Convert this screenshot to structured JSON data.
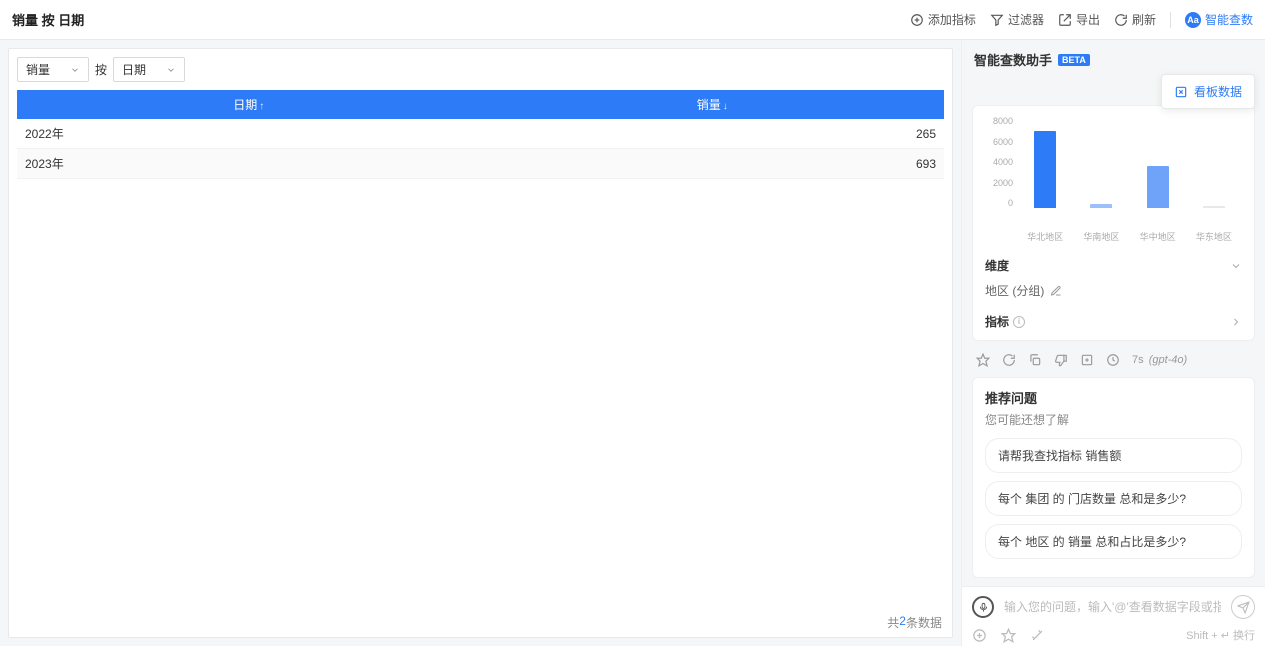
{
  "header": {
    "title": "销量 按 日期",
    "actions": {
      "add_metric": "添加指标",
      "filter": "过滤器",
      "export": "导出",
      "refresh": "刷新"
    },
    "brand": "智能查数"
  },
  "selectors": {
    "metric": "销量",
    "by_word": "按",
    "dimension": "日期"
  },
  "table": {
    "headers": {
      "date": "日期",
      "value": "销量",
      "sort_date": "↑",
      "sort_value": "↓"
    },
    "rows": [
      {
        "date": "2022年",
        "value": "265"
      },
      {
        "date": "2023年",
        "value": "693"
      }
    ],
    "footer_prefix": "共",
    "footer_count": "2",
    "footer_suffix": "条数据"
  },
  "assistant": {
    "title": "智能查数助手",
    "beta": "BETA",
    "kanban_btn": "看板数据",
    "chart_data": {
      "type": "bar",
      "y_ticks": [
        "8000",
        "6000",
        "4000",
        "2000",
        "0"
      ],
      "ylim": [
        0,
        8000
      ],
      "categories": [
        "华北地区",
        "华南地区",
        "华中地区",
        "华东地区"
      ],
      "values": [
        7000,
        400,
        3800,
        0
      ],
      "colors": [
        "#2d7bf6",
        "#9cc0fb",
        "#6fa3f9",
        "#e8e8e8"
      ]
    },
    "dimension_label": "维度",
    "dimension_value": "地区 (分组)",
    "metric_label": "指标",
    "result": {
      "timing": "7s",
      "model": "(gpt-4o)"
    },
    "suggestions": {
      "title": "推荐问题",
      "subtitle": "您可能还想了解",
      "items": [
        "请帮我查找指标 销售额",
        "每个 集团 的 门店数量 总和是多少?",
        "每个 地区 的 销量 总和占比是多少?"
      ]
    },
    "input": {
      "placeholder": "输入您的问题，输入'@'查看数据字段或指标",
      "hint": "Shift + ↵ 换行"
    }
  }
}
